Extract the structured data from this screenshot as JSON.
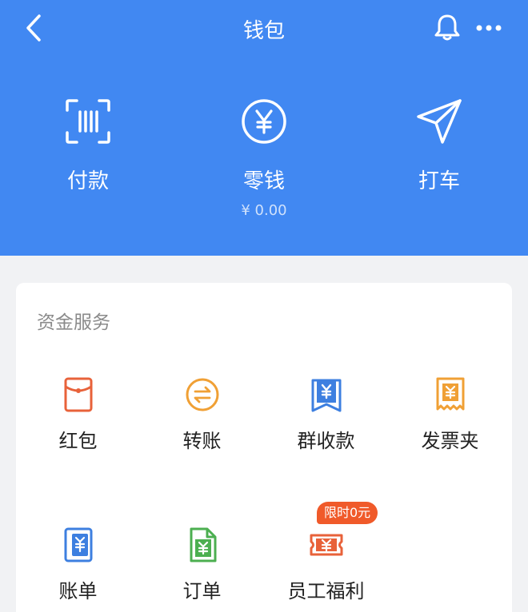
{
  "topbar": {
    "title": "钱包",
    "back_icon": "chevron-left-icon",
    "bell_icon": "bell-icon",
    "more_icon": "more-dots-icon"
  },
  "quick_actions": [
    {
      "label": "付款",
      "icon": "scan-code-icon"
    },
    {
      "label": "零钱",
      "icon": "yuan-circle-icon",
      "sub": "¥ 0.00"
    },
    {
      "label": "打车",
      "icon": "paper-plane-icon"
    }
  ],
  "services": {
    "title": "资金服务",
    "items": [
      {
        "label": "红包",
        "icon": "red-packet-icon",
        "color": "#e8623a"
      },
      {
        "label": "转账",
        "icon": "transfer-icon",
        "color": "#f0a035"
      },
      {
        "label": "群收款",
        "icon": "group-collect-icon",
        "color": "#3d7fe0"
      },
      {
        "label": "发票夹",
        "icon": "invoice-icon",
        "color": "#f0a035"
      },
      {
        "label": "账单",
        "icon": "bill-icon",
        "color": "#3d7fe0"
      },
      {
        "label": "订单",
        "icon": "order-icon",
        "color": "#4caf50"
      },
      {
        "label": "员工福利",
        "icon": "ticket-icon",
        "color": "#e8623a",
        "badge": "限时0元"
      }
    ]
  },
  "colors": {
    "header_bg": "#4188f2",
    "page_bg": "#f1f2f4",
    "badge_bg": "#f05a2a"
  }
}
